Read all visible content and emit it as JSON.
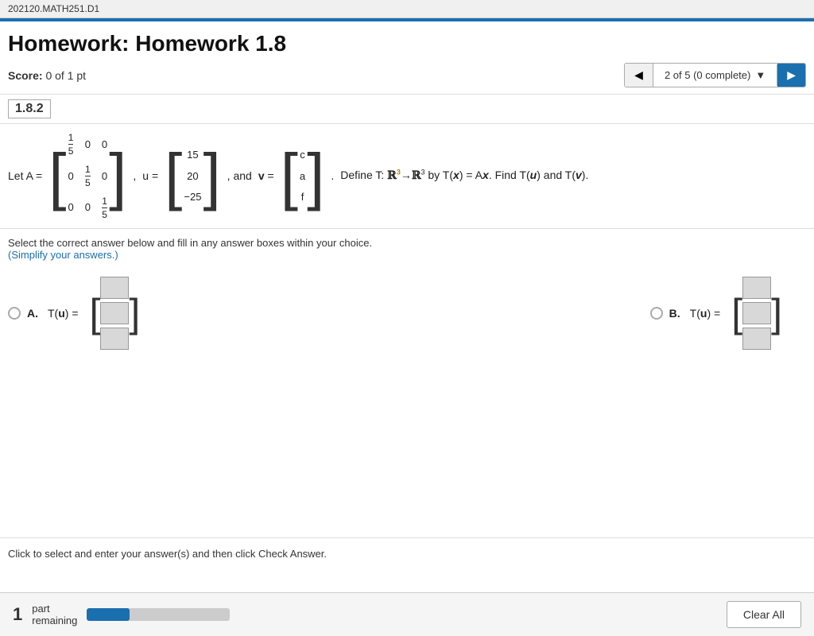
{
  "topbar": {
    "label": "202120.MATH251.D1"
  },
  "header": {
    "title": "Homework: Homework 1.8",
    "score_label": "Score:",
    "score_value": "0 of 1 pt",
    "nav_info": "2 of 5 (0 complete)",
    "nav_dropdown_symbol": "▼"
  },
  "problem": {
    "number": "1.8.2",
    "let_text": "Let A =",
    "comma1": ",",
    "u_label": "u =",
    "comma2": ", and",
    "v_label": "v =",
    "period": ".",
    "define_text": "Define T:",
    "r3_from": "ℝ",
    "arrow": "→",
    "r3_to": "ℝ",
    "by_text": "by T(",
    "x_var": "x",
    "eq_ax": ") = A",
    "find_text": ". Find T(",
    "u_var": "u",
    "and_text": ") and T(",
    "v_var": "v",
    "close_paren": ").",
    "matrix_A": [
      [
        "1/5",
        "0",
        "0"
      ],
      [
        "0",
        "1/5",
        "0"
      ],
      [
        "0",
        "0",
        "1/5"
      ]
    ],
    "matrix_u": [
      "15",
      "20",
      "−25"
    ],
    "matrix_v": [
      "c",
      "a",
      "f"
    ]
  },
  "instructions": {
    "line1": "Select the correct answer below and fill in any answer boxes within your choice.",
    "line2": "(Simplify your answers.)"
  },
  "options": {
    "option_a": {
      "label": "A.",
      "tu_label": "T(u) =",
      "inputs": [
        "",
        "",
        ""
      ],
      "bracket_hint": "[ ]"
    },
    "option_b": {
      "label": "B.",
      "tu_label": "T(u) =",
      "inputs": [
        "",
        "",
        ""
      ],
      "bracket_hint": "[ ]"
    }
  },
  "footer": {
    "instruction": "Click to select and enter your answer(s) and then click Check Answer."
  },
  "bottom_bar": {
    "part_number": "1",
    "part_label": "part",
    "remaining_label": "remaining",
    "progress_percent": 30,
    "clear_all_label": "Clear All"
  }
}
